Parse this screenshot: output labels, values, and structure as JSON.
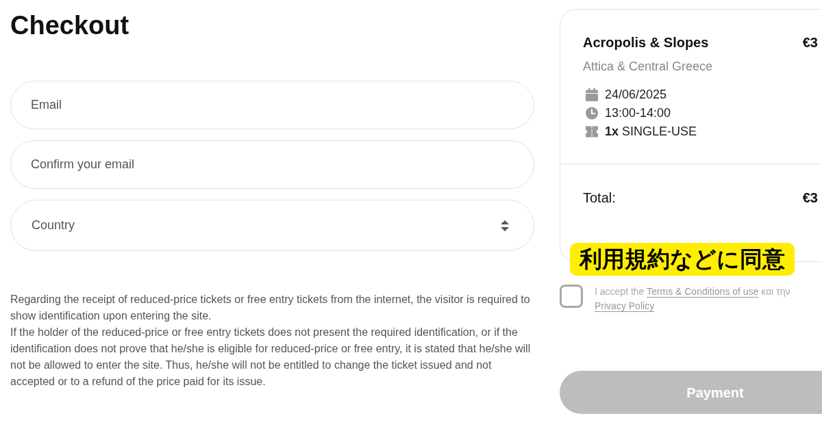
{
  "page_title": "Checkout",
  "form_fields": [
    {
      "kind": "text",
      "placeholder": "Email"
    },
    {
      "kind": "text",
      "placeholder": "Confirm your email"
    },
    {
      "kind": "select",
      "placeholder": "Country"
    }
  ],
  "notice": [
    "Regarding the receipt of reduced-price tickets or free entry tickets from the internet, the visitor is required to show identification upon entering the site.",
    "If the holder of the reduced-price or free entry tickets does not present the required identification, or if the identification does not prove that he/she is eligible for reduced-price or free entry, it is stated that he/she will not be allowed to enter the site. Thus, he/she will not be entitled to change the ticket issued and not accepted or to a refund of the price paid for its issue."
  ],
  "order_summary": {
    "title": "Acropolis & Slopes",
    "price": "€3",
    "region": "Attica & Central Greece",
    "details": [
      {
        "kind": "date",
        "text": "24/06/2025"
      },
      {
        "kind": "time",
        "text": "13:00-14:00"
      },
      {
        "kind": "ticket",
        "text": "**1x** SINGLE-USE"
      }
    ],
    "total_label": "Total:",
    "total_value": "€3"
  },
  "annotation": "利用規約などに同意",
  "terms": {
    "checked": false,
    "text": "I accept the",
    "link": "Terms & Conditions of use",
    "text_2": "και την",
    "link_2": "Privacy Policy"
  },
  "payment_button": {
    "label": "Payment",
    "disabled": true
  }
}
